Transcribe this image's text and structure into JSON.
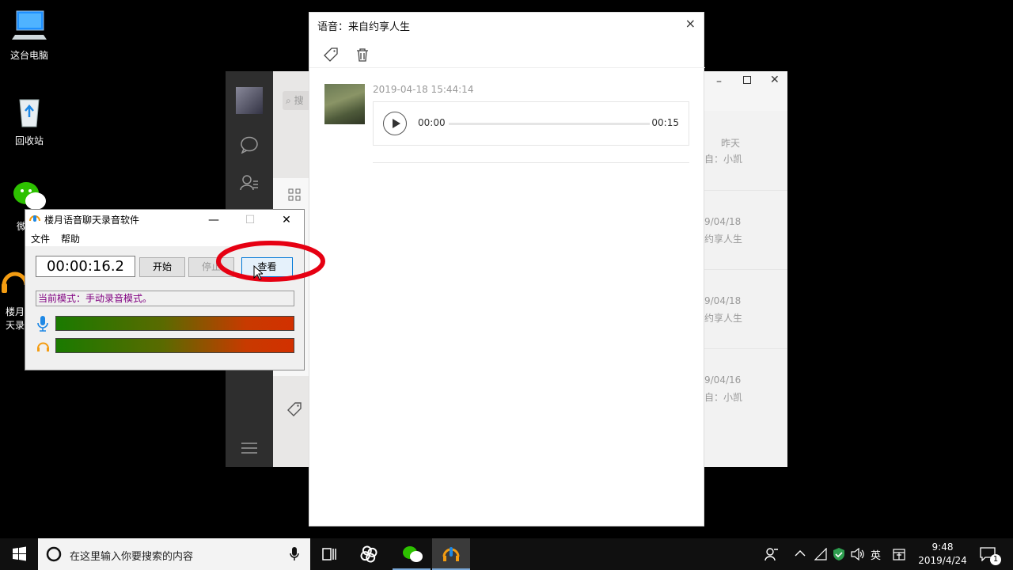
{
  "desktop": {
    "icons": [
      {
        "label": "这台电脑"
      },
      {
        "label": "回收站"
      },
      {
        "label": "微"
      },
      {
        "label_line1": "楼月",
        "label_line2": "天录"
      }
    ]
  },
  "wechat": {
    "search_placeholder": "搜",
    "list": [
      {
        "date": "昨天",
        "snippet": "自：小凯"
      },
      {
        "date": "9/04/18",
        "snippet": "约享人生"
      },
      {
        "date": "9/04/18",
        "snippet": "约享人生"
      },
      {
        "date": "9/04/16",
        "snippet": "自：小凯"
      }
    ]
  },
  "voice": {
    "title": "语音：来自约享人生",
    "close": "×",
    "timestamp": "2019-04-18 15:44:14",
    "current_time": "00:00",
    "duration": "00:15"
  },
  "recorder": {
    "title": "楼月语音聊天录音软件",
    "menu_file": "文件",
    "menu_help": "帮助",
    "timer": "00:00:16.2",
    "btn_start": "开始",
    "btn_stop": "停止",
    "btn_view": "查看",
    "mode_text": "当前模式：手动录音模式。"
  },
  "taskbar": {
    "search_placeholder": "在这里输入你要搜索的内容",
    "ime": "英",
    "time": "9:48",
    "date": "2019/4/24",
    "notification_count": "1"
  }
}
